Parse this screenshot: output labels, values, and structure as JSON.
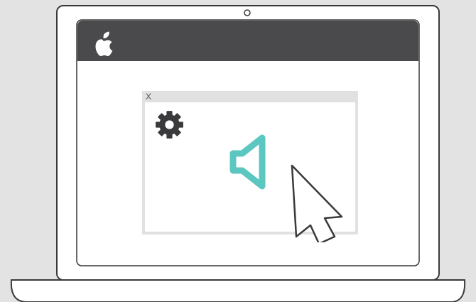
{
  "dialog": {
    "close_label": "X"
  },
  "icons": {
    "brand": "apple-logo-icon",
    "settings": "gear-icon",
    "audio": "speaker-icon",
    "pointer": "cursor-arrow-icon"
  },
  "colors": {
    "background": "#e3e3e3",
    "menu_bar": "#4a4a4c",
    "dialog_frame": "#e1e1e1",
    "speaker_accent": "#5bc7c0",
    "outline": "#3a3a3c"
  }
}
